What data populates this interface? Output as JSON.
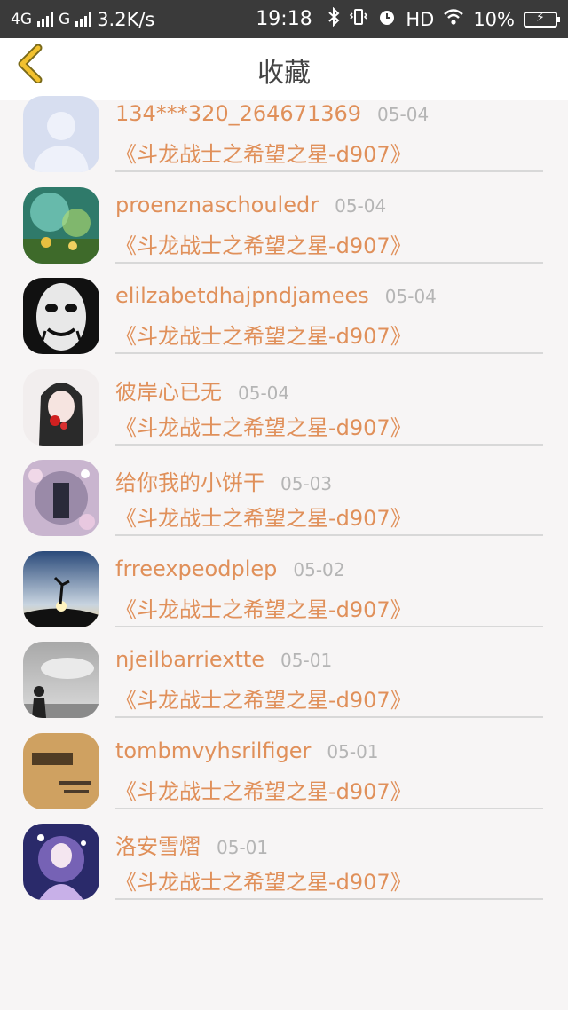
{
  "status_bar": {
    "network1": "4G",
    "network2": "G",
    "speed": "3.2K/s",
    "time": "19:18",
    "hd": "HD",
    "battery": "10%"
  },
  "header": {
    "title": "收藏",
    "back_icon": "chevron-left-icon"
  },
  "colors": {
    "accent": "#e0905a",
    "back_icon": "#f2c12e",
    "date": "#b5b5b5",
    "divider": "#d8d8d8"
  },
  "favorites": [
    {
      "user": "134***320_264671369",
      "date": "05-04",
      "book": "《斗龙战士之希望之星-d907》",
      "avatar": "default-person"
    },
    {
      "user": "proenznaschouledr",
      "date": "05-04",
      "book": "《斗龙战士之希望之星-d907》",
      "avatar": "fantasy-forest"
    },
    {
      "user": "elilzabetdhajpndjamees",
      "date": "05-04",
      "book": "《斗龙战士之希望之星-d907》",
      "avatar": "mask-face"
    },
    {
      "user": "彼岸心已无",
      "date": "05-04",
      "book": "《斗龙战士之希望之星-d907》",
      "avatar": "anime-girl"
    },
    {
      "user": "给你我的小饼干",
      "date": "05-03",
      "book": "《斗龙战士之希望之星-d907》",
      "avatar": "floral-collage"
    },
    {
      "user": "frreexpeodplep",
      "date": "05-02",
      "book": "《斗龙战士之希望之星-d907》",
      "avatar": "sunset-silhouette"
    },
    {
      "user": "njeilbarriextte",
      "date": "05-01",
      "book": "《斗龙战士之希望之星-d907》",
      "avatar": "cloudy-figure"
    },
    {
      "user": "tombmvyhsrilfiger",
      "date": "05-01",
      "book": "《斗龙战士之希望之星-d907》",
      "avatar": "graduation-wood"
    },
    {
      "user": "洛安雪熠",
      "date": "05-01",
      "book": "《斗龙战士之希望之星-d907》",
      "avatar": "anime-purple"
    }
  ]
}
